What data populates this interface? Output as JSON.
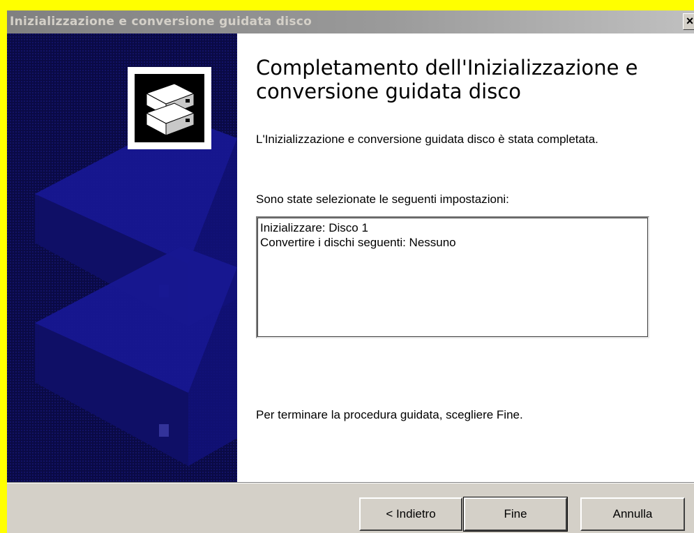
{
  "window": {
    "title": "Inizializzazione e conversione guidata disco",
    "close_glyph": "✕"
  },
  "side_panel": {
    "icon": "disk-stack-icon"
  },
  "content": {
    "heading": "Completamento dell'Inizializzazione e conversione guidata disco",
    "description": "L'Inizializzazione e conversione guidata disco è stata completata.",
    "selected_label": "Sono state selezionate le seguenti impostazioni:",
    "settings": [
      "Inizializzare: Disco 1",
      "Convertire i dischi seguenti: Nessuno"
    ],
    "finish_hint": "Per terminare la procedura guidata, scegliere Fine."
  },
  "buttons": {
    "back": "< Indietro",
    "finish": "Fine",
    "cancel": "Annulla"
  },
  "colors": {
    "page_border": "#ffff00",
    "titlebar": "#808080",
    "side_panel": "#0a0a40",
    "dialog_face": "#d4d0c8"
  }
}
